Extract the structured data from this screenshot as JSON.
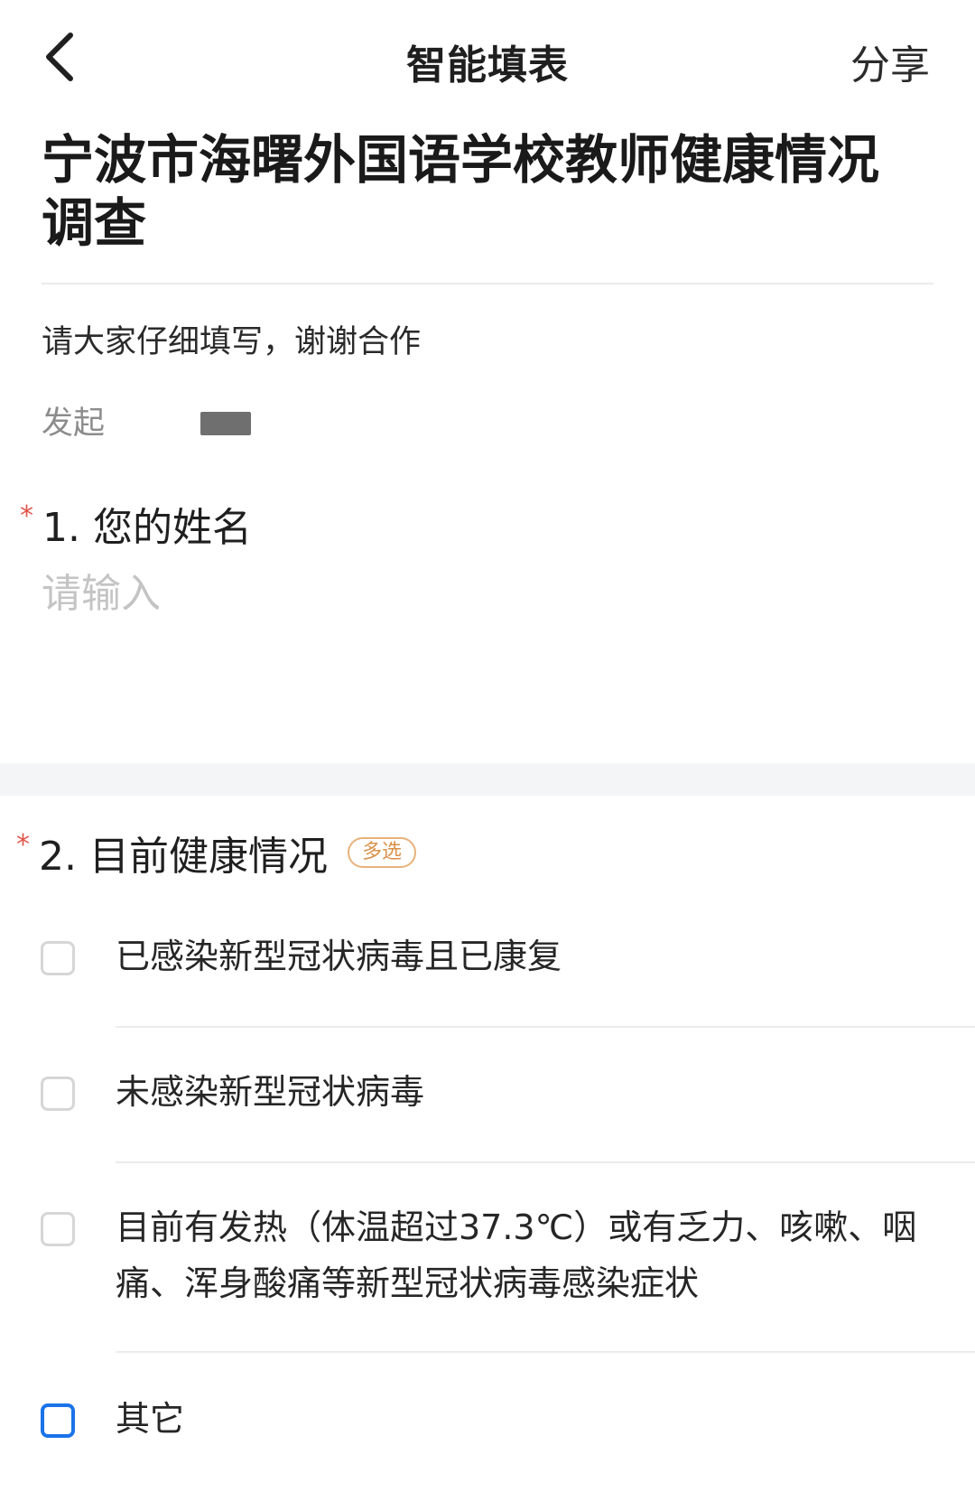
{
  "nav": {
    "title": "智能填表",
    "share_label": "分享"
  },
  "survey": {
    "title": "宁波市海曙外国语学校教师健康情况调查",
    "description": "请大家仔细填写，谢谢合作",
    "initiator_label": "发起"
  },
  "questions": [
    {
      "number_label": "1. 您的姓名",
      "required_mark": "*",
      "input_placeholder": "请输入"
    },
    {
      "number_label": "2. 目前健康情况",
      "required_mark": "*",
      "badge": "多选",
      "options": [
        {
          "label": "已感染新型冠状病毒且已康复",
          "checked": false
        },
        {
          "label": "未感染新型冠状病毒",
          "checked": false
        },
        {
          "label": "目前有发热（体温超过37.3℃）或有乏力、咳嗽、咽痛、浑身酸痛等新型冠状病毒感染症状",
          "checked": false
        },
        {
          "label": "其它",
          "checked": false,
          "focused": true
        }
      ]
    }
  ],
  "colors": {
    "required": "#e2564b",
    "badge": "#d9924a",
    "focus": "#1a73e8",
    "placeholder": "#c4c4c4"
  },
  "icons": {
    "back": "chevron-left-icon"
  }
}
